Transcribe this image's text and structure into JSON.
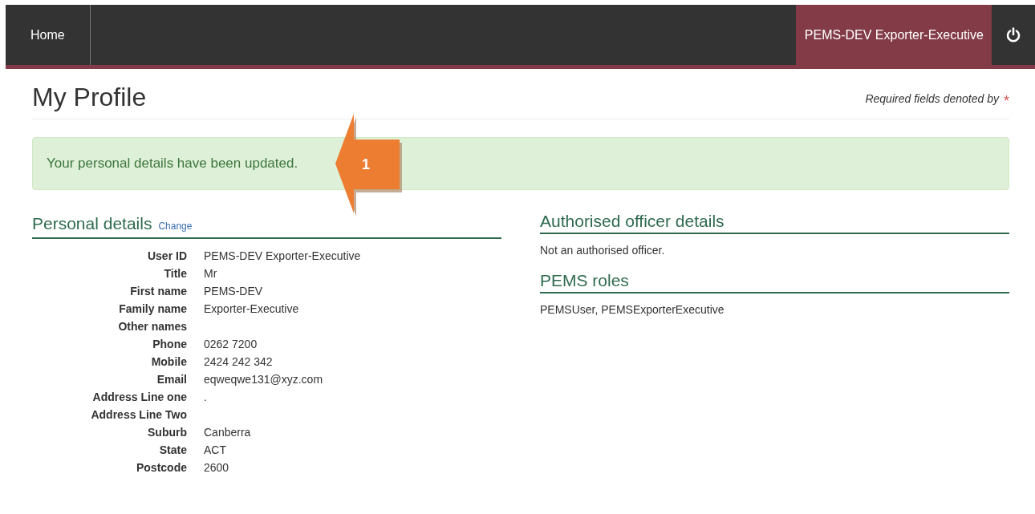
{
  "navbar": {
    "home": "Home",
    "user": "PEMS-DEV Exporter-Executive"
  },
  "page_title": "My Profile",
  "required_note": {
    "text": "Required fields denoted by",
    "marker": "*"
  },
  "alert": {
    "message": "Your personal details have been updated."
  },
  "callout": {
    "number": "1"
  },
  "personal_details": {
    "heading": "Personal details",
    "change_link": "Change",
    "fields": [
      {
        "label": "User ID",
        "value": "PEMS-DEV Exporter-Executive"
      },
      {
        "label": "Title",
        "value": "Mr"
      },
      {
        "label": "First name",
        "value": "PEMS-DEV"
      },
      {
        "label": "Family name",
        "value": "Exporter-Executive"
      },
      {
        "label": "Other names"
      },
      {
        "label": "Phone",
        "value": "0262 7200"
      },
      {
        "label": "Mobile",
        "value": "2424 242 342"
      },
      {
        "label": "Email",
        "value": "eqweqwe131@xyz.com"
      },
      {
        "label": "Address Line one",
        "value": "."
      },
      {
        "label": "Address Line Two"
      },
      {
        "label": "Suburb",
        "value": "Canberra"
      },
      {
        "label": "State",
        "value": "ACT"
      },
      {
        "label": "Postcode",
        "value": "2600"
      }
    ]
  },
  "authorised_officer": {
    "heading": "Authorised officer details",
    "text": "Not an authorised officer."
  },
  "pems_roles": {
    "heading": "PEMS roles",
    "text": "PEMSUser, PEMSExporterExecutive"
  }
}
